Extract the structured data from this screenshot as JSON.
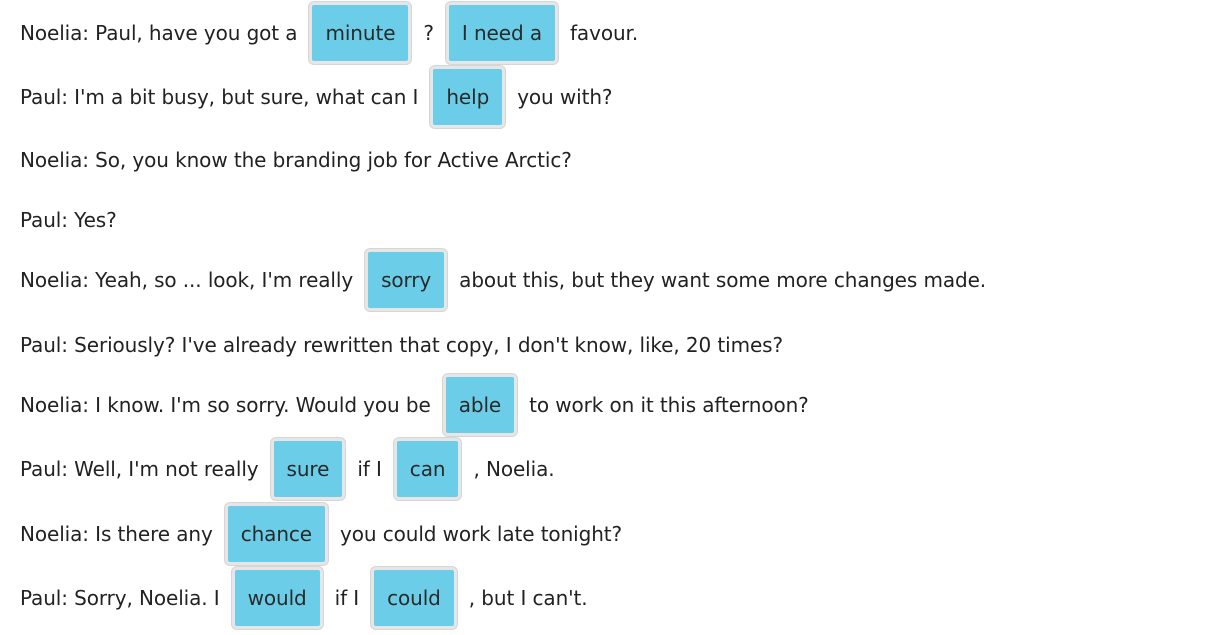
{
  "dialogue": [
    {
      "parts": [
        {
          "type": "text",
          "value": "Noelia: Paul, have you got a"
        },
        {
          "type": "chip",
          "value": "minute"
        },
        {
          "type": "text",
          "value": "?"
        },
        {
          "type": "chip",
          "value": "I need a"
        },
        {
          "type": "text",
          "value": "favour."
        }
      ]
    },
    {
      "parts": [
        {
          "type": "text",
          "value": "Paul: I'm a bit busy, but sure, what can I"
        },
        {
          "type": "chip",
          "value": "help"
        },
        {
          "type": "text",
          "value": "you with?"
        }
      ]
    },
    {
      "parts": [
        {
          "type": "text",
          "value": "Noelia: So, you know the branding job for Active Arctic?"
        }
      ]
    },
    {
      "parts": [
        {
          "type": "text",
          "value": "Paul: Yes?"
        }
      ]
    },
    {
      "parts": [
        {
          "type": "text",
          "value": "Noelia: Yeah, so ... look, I'm really"
        },
        {
          "type": "chip",
          "value": "sorry"
        },
        {
          "type": "text",
          "value": "about this, but they want some more changes made."
        }
      ]
    },
    {
      "parts": [
        {
          "type": "text",
          "value": "Paul: Seriously? I've already rewritten that copy, I don't know, like, 20 times?"
        }
      ]
    },
    {
      "parts": [
        {
          "type": "text",
          "value": "Noelia: I know. I'm so sorry. Would you be"
        },
        {
          "type": "chip",
          "value": "able"
        },
        {
          "type": "text",
          "value": "to work on it this afternoon?"
        }
      ]
    },
    {
      "parts": [
        {
          "type": "text",
          "value": "Paul: Well, I'm not really"
        },
        {
          "type": "chip",
          "value": "sure"
        },
        {
          "type": "text",
          "value": "if I"
        },
        {
          "type": "chip",
          "value": "can"
        },
        {
          "type": "text",
          "value": ", Noelia."
        }
      ]
    },
    {
      "parts": [
        {
          "type": "text",
          "value": "Noelia: Is there any"
        },
        {
          "type": "chip",
          "value": "chance"
        },
        {
          "type": "text",
          "value": "you could work late tonight?"
        }
      ]
    },
    {
      "parts": [
        {
          "type": "text",
          "value": "Paul: Sorry, Noelia. I"
        },
        {
          "type": "chip",
          "value": "would"
        },
        {
          "type": "text",
          "value": "if I"
        },
        {
          "type": "chip",
          "value": "could"
        },
        {
          "type": "text",
          "value": ", but I can't."
        }
      ]
    }
  ]
}
